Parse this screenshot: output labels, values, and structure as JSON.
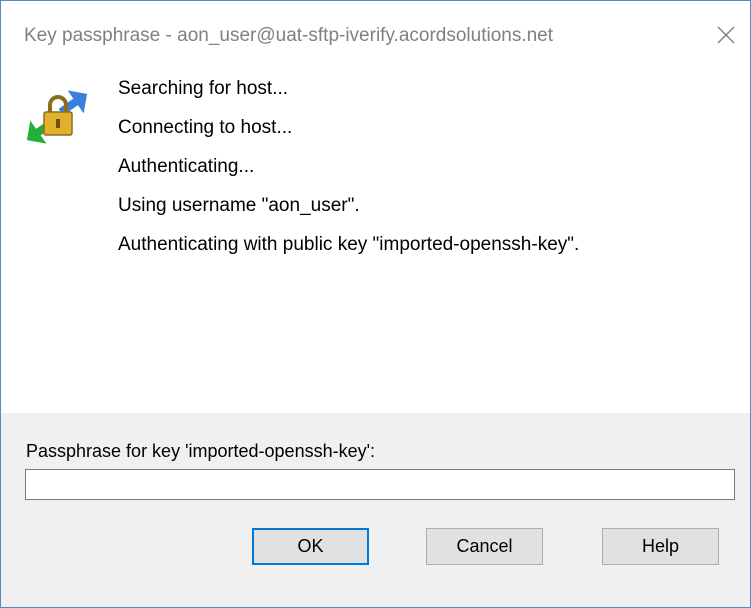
{
  "window": {
    "title": "Key passphrase - aon_user@uat-sftp-iverify.acordsolutions.net"
  },
  "icons": {
    "app": "putty-key-transfer-icon",
    "close": "close-icon"
  },
  "messages": [
    "Searching for host...",
    "Connecting to host...",
    "Authenticating...",
    "Using username \"aon_user\".",
    "Authenticating with public key \"imported-openssh-key\"."
  ],
  "passphrase": {
    "label": "Passphrase for key 'imported-openssh-key':",
    "value": "",
    "placeholder": ""
  },
  "buttons": {
    "ok": "OK",
    "cancel": "Cancel",
    "help": "Help"
  },
  "colors": {
    "accent": "#0078d7",
    "frame": "#5a87c7",
    "title_text": "#808080",
    "panel_bg": "#f0f0f0"
  }
}
